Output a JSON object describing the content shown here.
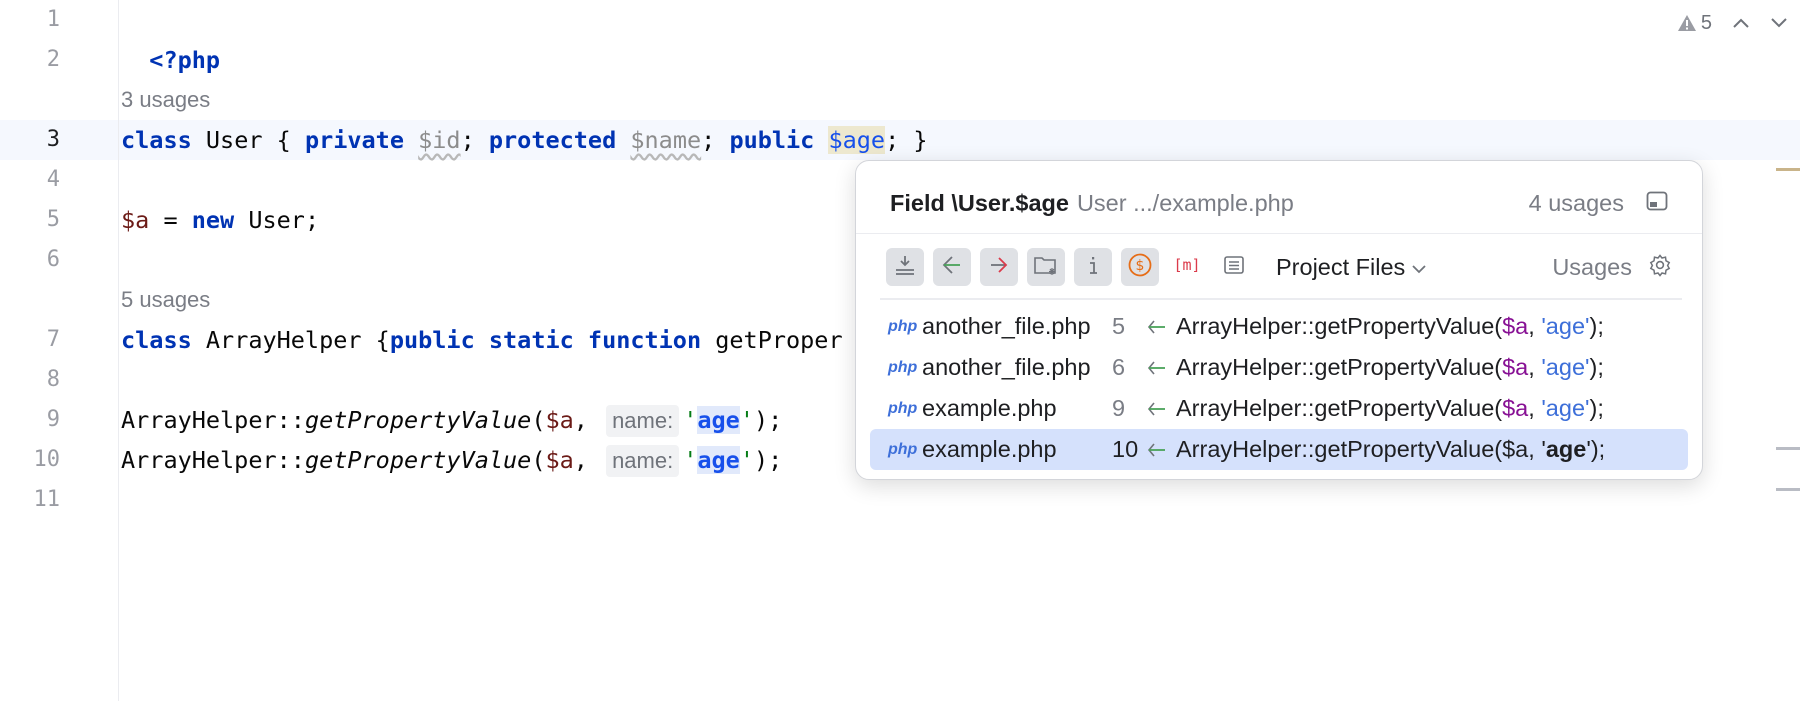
{
  "gutter": {
    "line_numbers": [
      "1",
      "2",
      "3",
      "4",
      "5",
      "6",
      "7",
      "8",
      "9",
      "10",
      "11"
    ]
  },
  "code": {
    "line1": "<?php",
    "usages_before_line3": "3 usages",
    "line3": {
      "kw_class": "class",
      "name": " User { ",
      "kw_private": "private",
      "sp1": " ",
      "var_id": "$id",
      "semi1": "; ",
      "kw_protected": "protected",
      "sp2": " ",
      "var_name": "$name",
      "semi2": "; ",
      "kw_public": "public",
      "sp3": " ",
      "var_age": "$age",
      "end": "; }"
    },
    "line5": {
      "var_a": "$a",
      "eq": " = ",
      "kw_new": "new",
      "rest": " User;"
    },
    "usages_before_line7": "5 usages",
    "line7": {
      "kw_class": "class",
      "name": " ArrayHelper {",
      "kw_public": "public",
      "sp1": " ",
      "kw_static": "static",
      "sp2": " ",
      "kw_function": "function",
      "rest": " getProper"
    },
    "line9": {
      "prefix": "ArrayHelper::",
      "method": "getPropertyValue",
      "paren": "(",
      "var_a": "$a",
      "comma": ", ",
      "hint": "name:",
      "q1": "'",
      "age": "age",
      "q2": "'",
      "end": ");"
    },
    "line10": {
      "prefix": "ArrayHelper::",
      "method": "getPropertyValue",
      "paren": "(",
      "var_a": "$a",
      "comma": ", ",
      "hint": "name:",
      "q1": "'",
      "age": "age",
      "q2": "'",
      "end": ");"
    }
  },
  "inspection": {
    "warning_icon": "warning-triangle-icon",
    "warning_count": "5"
  },
  "popup": {
    "title": "Field \\User.$age",
    "subtitle": "User .../example.php",
    "count": "4 usages",
    "scope": "Project Files",
    "usages_label": "Usages",
    "results": [
      {
        "tag": "php",
        "file": "another_file.php",
        "line": "5",
        "prefix": "ArrayHelper::getPropertyValue(",
        "var": "$a",
        "comma": ", ",
        "str": "'age'",
        "end": ");"
      },
      {
        "tag": "php",
        "file": "another_file.php",
        "line": "6",
        "prefix": "ArrayHelper::getPropertyValue(",
        "var": "$a",
        "comma": ", ",
        "str": "'age'",
        "end": ");"
      },
      {
        "tag": "php",
        "file": "example.php",
        "line": "9",
        "prefix": "ArrayHelper::getPropertyValue(",
        "var": "$a",
        "comma": ", ",
        "str": "'age'",
        "end": ");"
      },
      {
        "tag": "php",
        "file": "example.php",
        "line": "10",
        "prefix": "ArrayHelper::getPropertyValue(",
        "var": "$a",
        "comma": ", ",
        "q1": "'",
        "str_bold": "age",
        "q2": "'",
        "end": ");"
      }
    ]
  },
  "colors": {
    "keyword": "#0033b3",
    "selection": "#d5e1fc",
    "accent": "#3d6fd9"
  }
}
